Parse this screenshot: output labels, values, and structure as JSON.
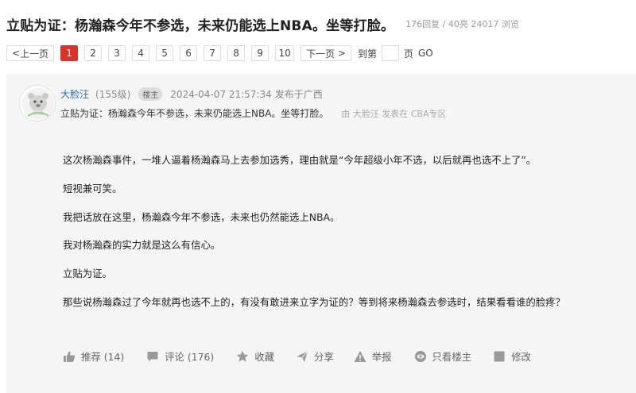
{
  "thread": {
    "title": "立贴为证：杨瀚森今年不参选，未来仍能选上NBA。坐等打脸。",
    "stats": "176回复 / 40亮 24017 浏览"
  },
  "pagination": {
    "prev": "上一页",
    "pages": [
      "1",
      "2",
      "3",
      "4",
      "5",
      "6",
      "7",
      "8",
      "9",
      "10"
    ],
    "current": "1",
    "next": "下一页",
    "goto_label": "到第",
    "page_unit": "页",
    "go": "GO"
  },
  "post": {
    "username": "大脸汪",
    "level": "(155级)",
    "badge": "楼主",
    "timestamp": "2024-04-07 21:57:34",
    "location": "发布于广西",
    "subtitle": "立贴为证：杨瀚森今年不参选，未来仍能选上NBA。坐等打脸。",
    "byline": "由 大脸汪 发表在 CBA专区",
    "paragraphs": [
      "这次杨瀚森事件，一堆人逼着杨瀚森马上去参加选秀，理由就是“今年超级小年不选，以后就再也选不上了”。",
      "短视兼可笑。",
      "我把话放在这里，杨瀚森今年不参选，未来也仍然能选上NBA。",
      "我对杨瀚森的实力就是这么有信心。",
      "立贴为证。",
      "那些说杨瀚森过了今年就再也选不上的，有没有敢进来立字为证的？等到将来杨瀚森去参选时，结果看看谁的脸疼？"
    ]
  },
  "actions": {
    "recommend": "推荐 (14)",
    "comment": "评论 (176)",
    "favorite": "收藏",
    "share": "分享",
    "report": "举报",
    "only_op": "只看楼主",
    "edit": "修改"
  },
  "colors": {
    "accent": "#d9342b",
    "username": "#2f6fb3",
    "card_bg": "#f5f5f5",
    "icon": "#999999"
  }
}
